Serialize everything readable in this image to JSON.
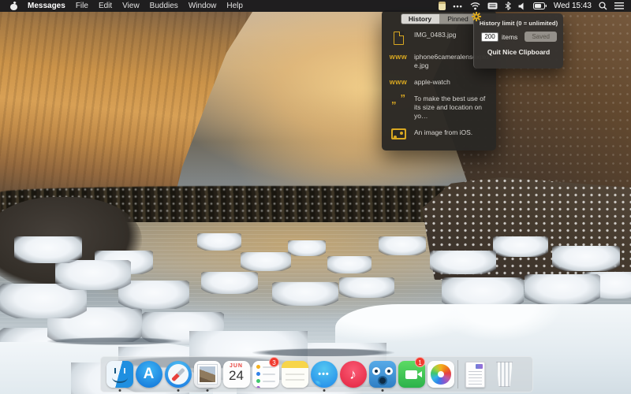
{
  "menubar": {
    "app_name": "Messages",
    "menus": [
      "File",
      "Edit",
      "View",
      "Buddies",
      "Window",
      "Help"
    ],
    "clock": "Wed 15:43"
  },
  "popover": {
    "tabs": [
      {
        "label": "History",
        "selected": true
      },
      {
        "label": "Pinned",
        "selected": false
      }
    ],
    "www_label": "www",
    "items": [
      {
        "icon": "file",
        "text": "IMG_0483.jpg"
      },
      {
        "icon": "www",
        "text": "iphone6cameralensexploe.jpg",
        "wrap": true
      },
      {
        "icon": "www",
        "text": "apple-watch"
      },
      {
        "icon": "quote",
        "text": "To make the best use of its size and location on yo…"
      },
      {
        "icon": "image",
        "text": "An image from iOS."
      }
    ]
  },
  "settings": {
    "title": "History limit (0 = unlimited)",
    "limit_value": "200",
    "limit_unit": "items",
    "save_button": "Saved",
    "quit_button": "Quit Nice Clipboard"
  },
  "dock": {
    "apps": [
      {
        "id": "finder",
        "running": true
      },
      {
        "id": "app-store",
        "running": false,
        "glyph": "A"
      },
      {
        "id": "safari",
        "running": true
      },
      {
        "id": "mail",
        "running": true
      },
      {
        "id": "calendar",
        "running": false,
        "month": "JUN",
        "day": "24"
      },
      {
        "id": "reminders",
        "running": false,
        "badge": "3"
      },
      {
        "id": "notes",
        "running": false
      },
      {
        "id": "messages",
        "running": true,
        "glyph": "•••"
      },
      {
        "id": "itunes",
        "running": false,
        "glyph": "♪"
      },
      {
        "id": "tweetbot",
        "running": true
      },
      {
        "id": "facetime",
        "running": false,
        "badge": "1"
      },
      {
        "id": "photos",
        "running": false
      },
      {
        "id": "separator"
      },
      {
        "id": "document",
        "running": false
      },
      {
        "id": "trash",
        "running": false
      }
    ]
  },
  "colors": {
    "accent_yellow": "#d9a821",
    "badge_red": "#f03b30"
  }
}
